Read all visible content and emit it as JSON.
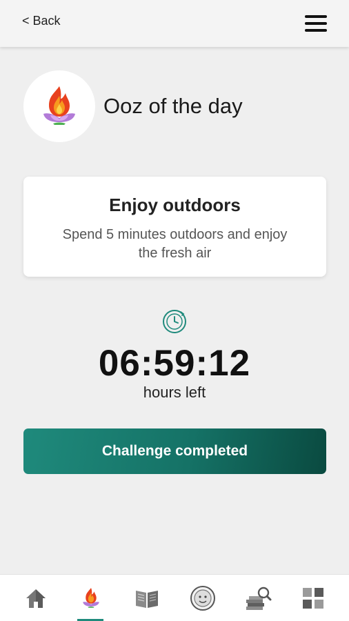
{
  "header": {
    "back_label": "< Back",
    "menu_icon": "hamburger-menu-icon"
  },
  "ooz": {
    "title": "Ooz of the day",
    "avatar_icon": "fire-lotus-icon"
  },
  "challenge": {
    "title": "Enjoy outdoors",
    "description": "Spend 5 minutes outdoors and enjoy the fresh air"
  },
  "timer": {
    "icon": "stopwatch-icon",
    "value": "06:59:12",
    "caption": "hours left"
  },
  "action": {
    "label": "Challenge completed"
  },
  "bottom_nav": {
    "items": [
      {
        "icon": "home-icon"
      },
      {
        "icon": "fire-lotus-icon",
        "active": true
      },
      {
        "icon": "open-book-icon"
      },
      {
        "icon": "face-badge-icon"
      },
      {
        "icon": "books-search-icon"
      },
      {
        "icon": "grid-blocks-icon"
      }
    ]
  },
  "colors": {
    "accent": "#1f8a7c",
    "accent_dark": "#0a4a40",
    "background": "#efefef"
  }
}
